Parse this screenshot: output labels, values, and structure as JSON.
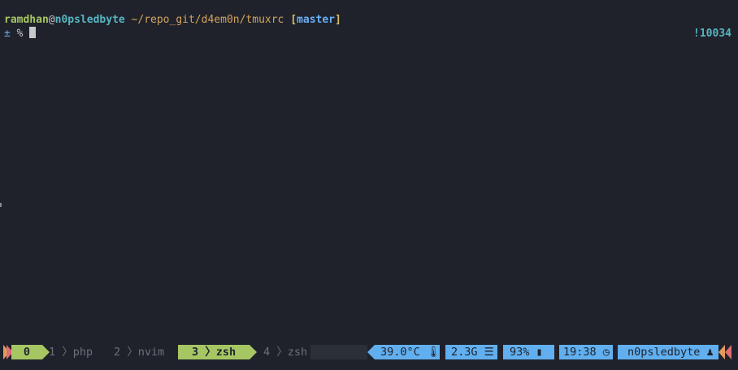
{
  "prompt": {
    "user": "ramdhan",
    "at": "@",
    "host": "n0psledbyte",
    "path": " ~/repo_git/d4em0n/tmuxrc ",
    "branch_open": "[",
    "branch": "master",
    "branch_close": "]",
    "plusminus": "±",
    "symbol": " % ",
    "right_status": "!10034"
  },
  "statusbar": {
    "windows": [
      {
        "index": "0",
        "name": "",
        "active": true
      },
      {
        "index": "1",
        "name": "php",
        "active": false
      },
      {
        "index": "2",
        "name": "nvim",
        "active": false
      },
      {
        "index": "3",
        "name": "zsh",
        "active": true
      },
      {
        "index": "4",
        "name": "zsh",
        "active": false
      }
    ],
    "temperature": "39.0°C",
    "memory": "2.3G",
    "battery": "93%",
    "time": "19:38",
    "hostname": "n0psledbyte"
  },
  "colors": {
    "background": "#1f222b",
    "green": "#a6c663",
    "blue": "#61afef",
    "orange": "#e39b5a",
    "pink": "#e06c75"
  },
  "icons": [
    "thermometer-icon",
    "database-icon",
    "battery-icon",
    "clock-icon",
    "user-icon"
  ]
}
